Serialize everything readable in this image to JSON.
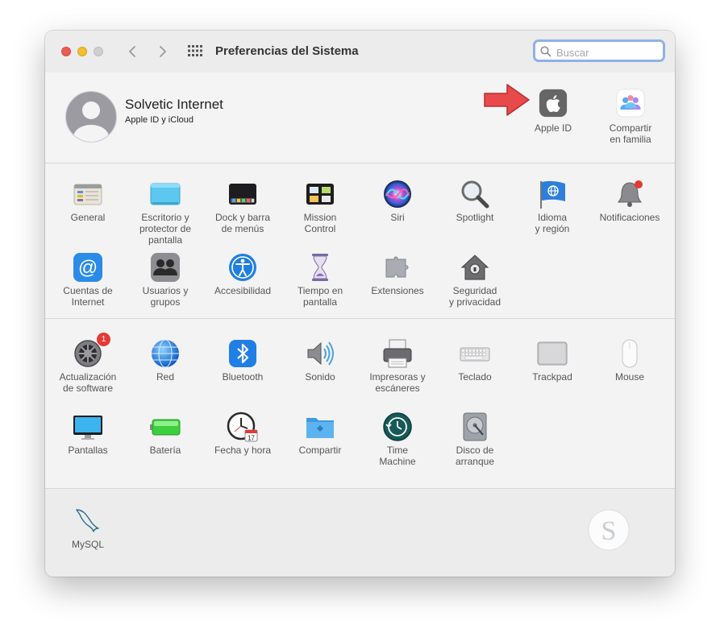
{
  "window": {
    "title": "Preferencias del Sistema"
  },
  "search": {
    "placeholder": "Buscar",
    "value": ""
  },
  "user": {
    "name": "Solvetic Internet",
    "subtitle": "Apple ID y iCloud",
    "items": [
      {
        "label": "Apple ID",
        "icon": "apple-logo-icon"
      },
      {
        "label": "Compartir\nen familia",
        "icon": "family-sharing-icon"
      }
    ]
  },
  "section_a": [
    {
      "label": "General",
      "icon": "general-icon"
    },
    {
      "label": "Escritorio y\nprotector de pantalla",
      "icon": "desktop-icon"
    },
    {
      "label": "Dock y barra\nde menús",
      "icon": "dock-icon"
    },
    {
      "label": "Mission\nControl",
      "icon": "mission-control-icon"
    },
    {
      "label": "Siri",
      "icon": "siri-icon"
    },
    {
      "label": "Spotlight",
      "icon": "spotlight-icon"
    },
    {
      "label": "Idioma\ny región",
      "icon": "language-flag-icon"
    },
    {
      "label": "Notificaciones",
      "icon": "bell-icon"
    },
    {
      "label": "Cuentas de\nInternet",
      "icon": "at-sign-icon"
    },
    {
      "label": "Usuarios y\ngrupos",
      "icon": "users-icon"
    },
    {
      "label": "Accesibilidad",
      "icon": "accessibility-icon"
    },
    {
      "label": "Tiempo en\npantalla",
      "icon": "hourglass-icon"
    },
    {
      "label": "Extensiones",
      "icon": "puzzle-icon"
    },
    {
      "label": "Seguridad\ny privacidad",
      "icon": "house-lock-icon"
    }
  ],
  "section_b": [
    {
      "label": "Actualización\nde software",
      "icon": "gear-update-icon",
      "badge": "1"
    },
    {
      "label": "Red",
      "icon": "globe-network-icon"
    },
    {
      "label": "Bluetooth",
      "icon": "bluetooth-icon"
    },
    {
      "label": "Sonido",
      "icon": "speaker-icon"
    },
    {
      "label": "Impresoras y\nescáneres",
      "icon": "printer-icon"
    },
    {
      "label": "Teclado",
      "icon": "keyboard-icon"
    },
    {
      "label": "Trackpad",
      "icon": "trackpad-icon"
    },
    {
      "label": "Mouse",
      "icon": "mouse-icon"
    },
    {
      "label": "Pantallas",
      "icon": "display-icon"
    },
    {
      "label": "Batería",
      "icon": "battery-icon"
    },
    {
      "label": "Fecha y hora",
      "icon": "clock-calendar-icon",
      "calendar_day": "17"
    },
    {
      "label": "Compartir",
      "icon": "shared-folder-icon"
    },
    {
      "label": "Time\nMachine",
      "icon": "time-machine-icon"
    },
    {
      "label": "Disco de\narranque",
      "icon": "hard-disk-icon"
    }
  ],
  "section_c": [
    {
      "label": "MySQL",
      "icon": "mysql-dolphin-icon"
    }
  ],
  "colors": {
    "accent_blue": "#1e88e5",
    "badge_red": "#e53935",
    "arrow_red": "#e8494a"
  }
}
